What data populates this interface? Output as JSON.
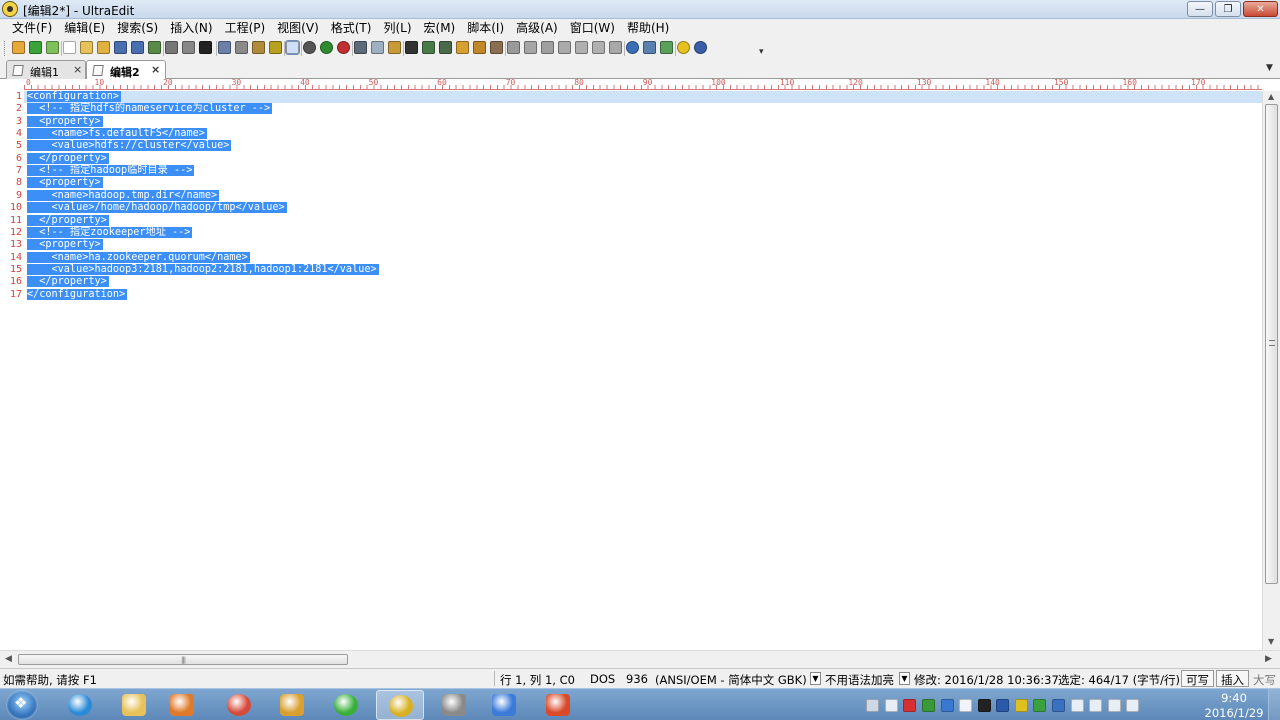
{
  "window": {
    "title": "[编辑2*] - UltraEdit",
    "minimize_glyph": "—",
    "maximize_glyph": "❐",
    "close_glyph": "✕"
  },
  "menu": [
    "文件(F)",
    "编辑(E)",
    "搜索(S)",
    "插入(N)",
    "工程(P)",
    "视图(V)",
    "格式(T)",
    "列(L)",
    "宏(M)",
    "脚本(I)",
    "高级(A)",
    "窗口(W)",
    "帮助(H)"
  ],
  "toolbar": {
    "buttons": [
      {
        "name": "new-project-icon",
        "color": "#e6a93a"
      },
      {
        "name": "back-icon",
        "color": "#3aa33a"
      },
      {
        "name": "forward-icon",
        "color": "#7fc05a"
      },
      {
        "name": "new-file-icon",
        "color": "#ffffff"
      },
      {
        "name": "open-file-icon",
        "color": "#e7c25a"
      },
      {
        "name": "open-folder-icon",
        "color": "#e0b040"
      },
      {
        "name": "save-icon",
        "color": "#4a6fb0"
      },
      {
        "name": "save-all-icon",
        "color": "#4a6fb0"
      },
      {
        "name": "save-as-icon",
        "color": "#5a8a4a"
      },
      {
        "name": "print-icon",
        "color": "#777777"
      },
      {
        "name": "print-preview-icon",
        "color": "#888888"
      },
      {
        "name": "font-icon",
        "color": "#222222"
      },
      {
        "name": "hex-edit-icon",
        "color": "#6b7fa8"
      },
      {
        "name": "column-mode-icon",
        "color": "#8a8a8a"
      },
      {
        "name": "word-wrap-icon",
        "color": "#b08c3a"
      },
      {
        "name": "file-tree-icon",
        "color": "#b8a020"
      },
      {
        "name": "line-numbers-icon",
        "color": "#c8d8f0"
      },
      {
        "name": "nav-back-icon",
        "color": "#555555"
      },
      {
        "name": "nav-forward-icon",
        "color": "#2e8b2e"
      },
      {
        "name": "stop-icon",
        "color": "#c03030"
      },
      {
        "name": "cut-icon",
        "color": "#5c6b7a"
      },
      {
        "name": "copy-icon",
        "color": "#9fb0c0"
      },
      {
        "name": "paste-icon",
        "color": "#c99a3c"
      },
      {
        "name": "find-icon",
        "color": "#333333"
      },
      {
        "name": "find-next-icon",
        "color": "#4a7a4a"
      },
      {
        "name": "find-in-files-icon",
        "color": "#4a6a4a"
      },
      {
        "name": "replace-icon",
        "color": "#d8a030"
      },
      {
        "name": "replace-in-files-icon",
        "color": "#c08828"
      },
      {
        "name": "goto-icon",
        "color": "#8a7050"
      },
      {
        "name": "align-left-icon",
        "color": "#9a9a9a"
      },
      {
        "name": "align-center-icon",
        "color": "#a6a6a6"
      },
      {
        "name": "align-right-icon",
        "color": "#a0a0a0"
      },
      {
        "name": "justify-icon",
        "color": "#aaaaaa"
      },
      {
        "name": "indent-icon",
        "color": "#b0b0b0"
      },
      {
        "name": "outdent-icon",
        "color": "#b0b0b0"
      },
      {
        "name": "format-icon",
        "color": "#a8a8a8"
      },
      {
        "name": "browser-icon",
        "color": "#3a6fb8"
      },
      {
        "name": "ftp-icon",
        "color": "#5a80b0"
      },
      {
        "name": "sync-icon",
        "color": "#5aa05a"
      },
      {
        "name": "tip-icon",
        "color": "#e8c020"
      },
      {
        "name": "help-icon",
        "color": "#3a5fa8"
      }
    ]
  },
  "tabs": [
    {
      "label": "编辑1",
      "close": "×",
      "active": false
    },
    {
      "label": "编辑2",
      "close": "×",
      "active": true
    }
  ],
  "ruler": {
    "labels": [
      "0",
      "10",
      "20",
      "30",
      "40",
      "50",
      "60",
      "70",
      "80",
      "90",
      "100",
      "110",
      "120",
      "130",
      "140",
      "150",
      "160",
      "170"
    ]
  },
  "editor": {
    "lines": [
      "<configuration>",
      "  <!-- 指定hdfs的nameservice为cluster -->",
      "  <property>",
      "    <name>fs.defaultFS</name>",
      "    <value>hdfs://cluster</value>",
      "  </property>",
      "  <!-- 指定hadoop临时目录 -->",
      "  <property>",
      "    <name>hadoop.tmp.dir</name>",
      "    <value>/home/hadoop/hadoop/tmp</value>",
      "  </property>",
      "  <!-- 指定zookeeper地址 -->",
      "  <property>",
      "    <name>ha.zookeeper.quorum</name>",
      "    <value>hadoop3:2181,hadoop2:2181,hadoop1:2181</value>",
      "  </property>",
      "</configuration>"
    ],
    "selection_color": "#3c8ff7",
    "current_line_color": "#cfe3f8",
    "line_number_color": "#d04040"
  },
  "statusbar": {
    "help": "如需帮助, 请按 F1",
    "position": "行 1, 列 1, C0",
    "line_ending": "DOS",
    "codepage": "936",
    "encoding": "(ANSI/OEM - 简体中文 GBK)",
    "highlighting": "不用语法加亮",
    "modified": "修改: 2016/1/28 10:36:37",
    "selection": "选定: 464/17 (字节/行)",
    "writable": "可写",
    "insert_mode": "插入",
    "caps": "大写"
  },
  "taskbar": {
    "apps": [
      {
        "name": "ie-taskbar-icon",
        "color": "#2a8ad8"
      },
      {
        "name": "explorer-taskbar-icon",
        "color": "#e7c25a"
      },
      {
        "name": "media-player-taskbar-icon",
        "color": "#e07a2a"
      },
      {
        "name": "chrome-taskbar-icon",
        "color": "#d64a3a"
      },
      {
        "name": "security-app-taskbar-icon",
        "color": "#d8a030"
      },
      {
        "name": "browser-360-taskbar-icon",
        "color": "#3ab03a"
      },
      {
        "name": "ultraedit-taskbar-icon",
        "color": "#d8b020"
      },
      {
        "name": "printer-app-taskbar-icon",
        "color": "#8a8a8a"
      },
      {
        "name": "virtualbox-taskbar-icon",
        "color": "#3a7ad8"
      },
      {
        "name": "game-app-taskbar-icon",
        "color": "#d84a2a"
      }
    ],
    "tray": [
      {
        "name": "keyboard-tray-icon",
        "color": "#cfd8e6"
      },
      {
        "name": "pen-tray-icon",
        "color": "#e8eef6"
      },
      {
        "name": "antivirus-tray-icon",
        "color": "#d83030"
      },
      {
        "name": "tool-tray-icon",
        "color": "#3a9a3a"
      },
      {
        "name": "network-share-tray-icon",
        "color": "#3a78d0"
      },
      {
        "name": "windows-tray-icon",
        "color": "#f0f4fa"
      },
      {
        "name": "qq-tray-icon",
        "color": "#222222"
      },
      {
        "name": "bluetooth-tray-icon",
        "color": "#2a5aa8"
      },
      {
        "name": "add-tray-icon",
        "color": "#e0c020"
      },
      {
        "name": "shield-tray-icon",
        "color": "#3aa040"
      },
      {
        "name": "display-tray-icon",
        "color": "#3a70c0"
      },
      {
        "name": "flag-tray-icon",
        "color": "#e8eef6"
      },
      {
        "name": "power-tray-icon",
        "color": "#e8eef6"
      },
      {
        "name": "volume-tray-icon",
        "color": "#e8eef6"
      },
      {
        "name": "signal-tray-icon",
        "color": "#e8eef6"
      }
    ],
    "time": "9:40",
    "date": "2016/1/29"
  }
}
